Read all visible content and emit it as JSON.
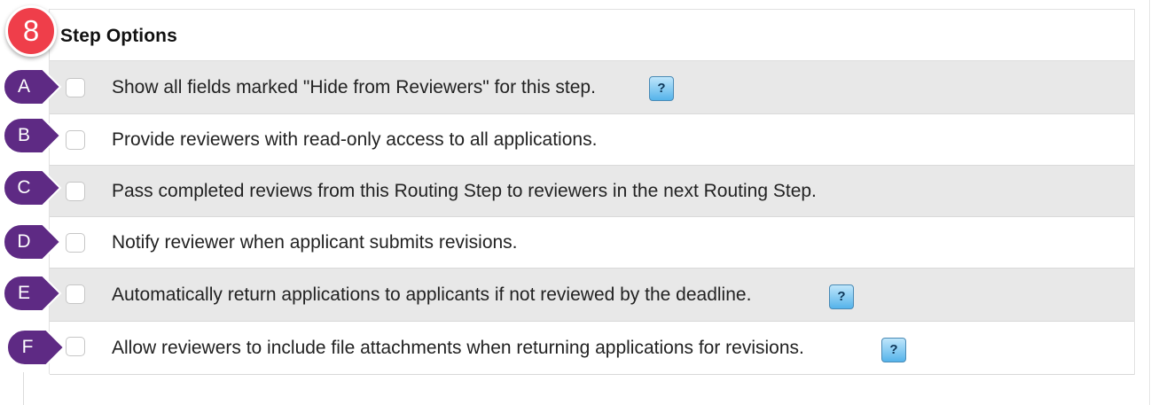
{
  "step_badge": "8",
  "panel": {
    "title": "Step Options"
  },
  "options": [
    {
      "marker": "A",
      "label": "Show all fields marked \"Hide from Reviewers\" for this step.",
      "help": "?",
      "checked": false
    },
    {
      "marker": "B",
      "label": "Provide reviewers with read-only access to all applications.",
      "checked": false
    },
    {
      "marker": "C",
      "label": "Pass completed reviews from this Routing Step to reviewers in the next Routing Step.",
      "checked": false
    },
    {
      "marker": "D",
      "label": "Notify reviewer when applicant submits revisions.",
      "checked": false
    },
    {
      "marker": "E",
      "label": "Automatically return applications to applicants if not reviewed by the deadline.",
      "help": "?",
      "checked": false
    },
    {
      "marker": "F",
      "label": "Allow reviewers to include file attachments when returning applications for revisions.",
      "help": "?",
      "checked": false
    }
  ],
  "colors": {
    "badge": "#ef3e4a",
    "marker": "#5e2a84",
    "row_shaded": "#e8e8e8",
    "help_button": "#55b3ea"
  },
  "icons": {
    "help": "question-mark-icon",
    "marker": "callout-pin-icon"
  }
}
